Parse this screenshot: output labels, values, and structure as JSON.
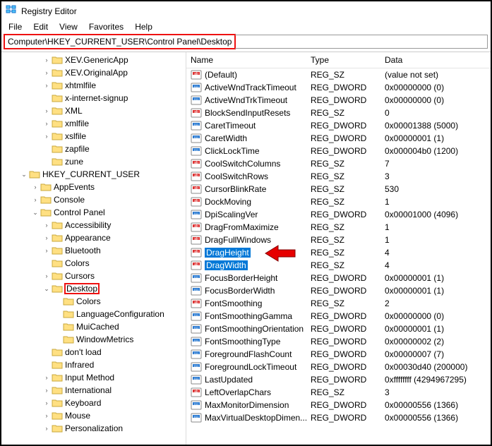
{
  "window": {
    "title": "Registry Editor"
  },
  "menu": {
    "file": "File",
    "edit": "Edit",
    "view": "View",
    "favorites": "Favorites",
    "help": "Help"
  },
  "address": {
    "path": "Computer\\HKEY_CURRENT_USER\\Control Panel\\Desktop"
  },
  "tree": {
    "items": [
      {
        "indent": 3,
        "exp": ">",
        "label": "XEV.GenericApp"
      },
      {
        "indent": 3,
        "exp": ">",
        "label": "XEV.OriginalApp"
      },
      {
        "indent": 3,
        "exp": ">",
        "label": "xhtmlfile"
      },
      {
        "indent": 3,
        "exp": "",
        "label": "x-internet-signup"
      },
      {
        "indent": 3,
        "exp": ">",
        "label": "XML"
      },
      {
        "indent": 3,
        "exp": ">",
        "label": "xmlfile"
      },
      {
        "indent": 3,
        "exp": ">",
        "label": "xslfile"
      },
      {
        "indent": 3,
        "exp": "",
        "label": "zapfile"
      },
      {
        "indent": 3,
        "exp": "",
        "label": "zune"
      },
      {
        "indent": 1,
        "exp": "v",
        "label": "HKEY_CURRENT_USER"
      },
      {
        "indent": 2,
        "exp": ">",
        "label": "AppEvents"
      },
      {
        "indent": 2,
        "exp": ">",
        "label": "Console"
      },
      {
        "indent": 2,
        "exp": "v",
        "label": "Control Panel"
      },
      {
        "indent": 3,
        "exp": ">",
        "label": "Accessibility"
      },
      {
        "indent": 3,
        "exp": ">",
        "label": "Appearance"
      },
      {
        "indent": 3,
        "exp": ">",
        "label": "Bluetooth"
      },
      {
        "indent": 3,
        "exp": "",
        "label": "Colors"
      },
      {
        "indent": 3,
        "exp": ">",
        "label": "Cursors"
      },
      {
        "indent": 3,
        "exp": "v",
        "label": "Desktop",
        "red": true
      },
      {
        "indent": 4,
        "exp": "",
        "label": "Colors"
      },
      {
        "indent": 4,
        "exp": "",
        "label": "LanguageConfiguration"
      },
      {
        "indent": 4,
        "exp": "",
        "label": "MuiCached"
      },
      {
        "indent": 4,
        "exp": "",
        "label": "WindowMetrics"
      },
      {
        "indent": 3,
        "exp": "",
        "label": "don't load"
      },
      {
        "indent": 3,
        "exp": "",
        "label": "Infrared"
      },
      {
        "indent": 3,
        "exp": ">",
        "label": "Input Method"
      },
      {
        "indent": 3,
        "exp": ">",
        "label": "International"
      },
      {
        "indent": 3,
        "exp": ">",
        "label": "Keyboard"
      },
      {
        "indent": 3,
        "exp": ">",
        "label": "Mouse"
      },
      {
        "indent": 3,
        "exp": ">",
        "label": "Personalization"
      }
    ]
  },
  "list": {
    "headers": {
      "name": "Name",
      "type": "Type",
      "data": "Data"
    },
    "rows": [
      {
        "icon": "sz",
        "name": "(Default)",
        "type": "REG_SZ",
        "data": "(value not set)"
      },
      {
        "icon": "dw",
        "name": "ActiveWndTrackTimeout",
        "type": "REG_DWORD",
        "data": "0x00000000 (0)"
      },
      {
        "icon": "dw",
        "name": "ActiveWndTrkTimeout",
        "type": "REG_DWORD",
        "data": "0x00000000 (0)"
      },
      {
        "icon": "sz",
        "name": "BlockSendInputResets",
        "type": "REG_SZ",
        "data": "0"
      },
      {
        "icon": "dw",
        "name": "CaretTimeout",
        "type": "REG_DWORD",
        "data": "0x00001388 (5000)"
      },
      {
        "icon": "dw",
        "name": "CaretWidth",
        "type": "REG_DWORD",
        "data": "0x00000001 (1)"
      },
      {
        "icon": "dw",
        "name": "ClickLockTime",
        "type": "REG_DWORD",
        "data": "0x000004b0 (1200)"
      },
      {
        "icon": "sz",
        "name": "CoolSwitchColumns",
        "type": "REG_SZ",
        "data": "7"
      },
      {
        "icon": "sz",
        "name": "CoolSwitchRows",
        "type": "REG_SZ",
        "data": "3"
      },
      {
        "icon": "sz",
        "name": "CursorBlinkRate",
        "type": "REG_SZ",
        "data": "530"
      },
      {
        "icon": "sz",
        "name": "DockMoving",
        "type": "REG_SZ",
        "data": "1"
      },
      {
        "icon": "dw",
        "name": "DpiScalingVer",
        "type": "REG_DWORD",
        "data": "0x00001000 (4096)"
      },
      {
        "icon": "sz",
        "name": "DragFromMaximize",
        "type": "REG_SZ",
        "data": "1"
      },
      {
        "icon": "sz",
        "name": "DragFullWindows",
        "type": "REG_SZ",
        "data": "1"
      },
      {
        "icon": "sz",
        "name": "DragHeight",
        "type": "REG_SZ",
        "data": "4",
        "sel": true
      },
      {
        "icon": "sz",
        "name": "DragWidth",
        "type": "REG_SZ",
        "data": "4",
        "sel": true
      },
      {
        "icon": "dw",
        "name": "FocusBorderHeight",
        "type": "REG_DWORD",
        "data": "0x00000001 (1)"
      },
      {
        "icon": "dw",
        "name": "FocusBorderWidth",
        "type": "REG_DWORD",
        "data": "0x00000001 (1)"
      },
      {
        "icon": "sz",
        "name": "FontSmoothing",
        "type": "REG_SZ",
        "data": "2"
      },
      {
        "icon": "dw",
        "name": "FontSmoothingGamma",
        "type": "REG_DWORD",
        "data": "0x00000000 (0)"
      },
      {
        "icon": "dw",
        "name": "FontSmoothingOrientation",
        "type": "REG_DWORD",
        "data": "0x00000001 (1)"
      },
      {
        "icon": "dw",
        "name": "FontSmoothingType",
        "type": "REG_DWORD",
        "data": "0x00000002 (2)"
      },
      {
        "icon": "dw",
        "name": "ForegroundFlashCount",
        "type": "REG_DWORD",
        "data": "0x00000007 (7)"
      },
      {
        "icon": "dw",
        "name": "ForegroundLockTimeout",
        "type": "REG_DWORD",
        "data": "0x00030d40 (200000)"
      },
      {
        "icon": "dw",
        "name": "LastUpdated",
        "type": "REG_DWORD",
        "data": "0xffffffff (4294967295)"
      },
      {
        "icon": "sz",
        "name": "LeftOverlapChars",
        "type": "REG_SZ",
        "data": "3"
      },
      {
        "icon": "dw",
        "name": "MaxMonitorDimension",
        "type": "REG_DWORD",
        "data": "0x00000556 (1366)"
      },
      {
        "icon": "dw",
        "name": "MaxVirtualDesktopDimen...",
        "type": "REG_DWORD",
        "data": "0x00000556 (1366)"
      }
    ]
  }
}
